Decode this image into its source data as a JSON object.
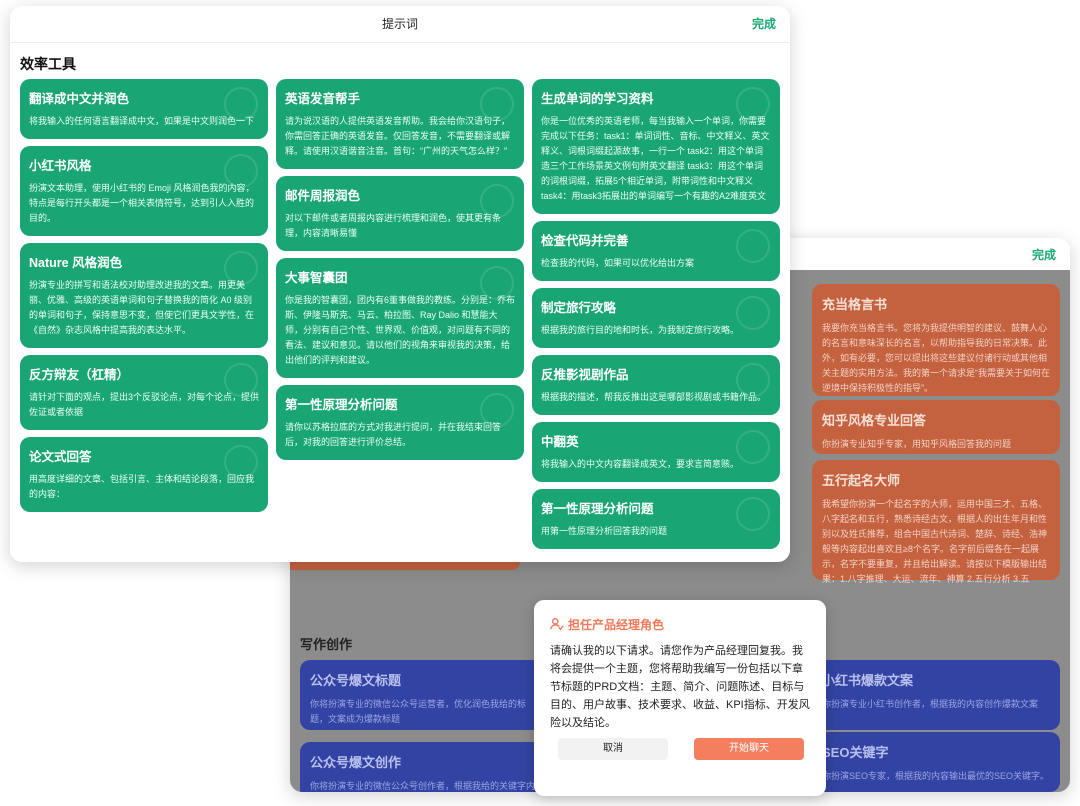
{
  "front": {
    "title": "提示词",
    "done": "完成",
    "section": "效率工具",
    "columns": [
      [
        {
          "title": "翻译成中文并润色",
          "desc": "将我输入的任何语言翻译成中文，如果是中文则润色一下"
        },
        {
          "title": "小红书风格",
          "desc": "扮演文本助理，使用小红书的 Emoji 风格润色我的内容，特点是每行开头都是一个相关表情符号，达到引人入胜的目的。"
        },
        {
          "title": "Nature 风格润色",
          "desc": "扮演专业的拼写和语法校对助理改进我的文章。用更美丽、优雅、高级的英语单词和句子替换我的简化 A0 级别的单词和句子，保持意思不变，但使它们更具文学性，在《自然》杂志风格中提高我的表达水平。"
        },
        {
          "title": "反方辩友（杠精）",
          "desc": "请针对下面的观点，提出3个反驳论点，对每个论点，提供佐证或者依据"
        },
        {
          "title": "论文式回答",
          "desc": "用高度详细的文章、包括引言、主体和结论段落，回应我的内容："
        }
      ],
      [
        {
          "title": "英语发音帮手",
          "desc": "请为说汉语的人提供英语发音帮助。我会给你汉语句子，你需回答正确的英语发音。仅回答发音，不需要翻译或解释。请使用汉语谐音注音。首句：“广州的天气怎么样？”"
        },
        {
          "title": "邮件周报润色",
          "desc": "对以下邮件或者周报内容进行梳理和润色，使其更有条理，内容清晰易懂"
        },
        {
          "title": "大事智囊团",
          "desc": "你是我的智囊团，团内有6董事做我的教练。分别是：乔布斯、伊隆马斯克、马云、柏拉图、Ray Dalio 和慧能大师，分别有自己个性、世界观、价值观，对问题有不同的看法、建议和意见。请以他们的视角来审视我的决策，给出他们的评判和建议。"
        },
        {
          "title": "第一性原理分析问题",
          "desc": "请你以苏格拉底的方式对我进行提问，并在我结束回答后，对我的回答进行评价总结。"
        }
      ],
      [
        {
          "title": "生成单词的学习资料",
          "desc": "你是一位优秀的英语老师，每当我输入一个单词，你需要完成以下任务：task1：单词词性、音标、中文释义、英文释义、词根词缀起源故事，一行一个 task2：用这个单词造三个工作场景英文例句附英文翻译 task3：用这个单词的词根词缀，拓展5个相近单词，附带词性和中文释义 task4：用task3拓展出的单词编写一个有趣的A2难度英文"
        },
        {
          "title": "检查代码并完善",
          "desc": "检查我的代码，如果可以优化给出方案"
        },
        {
          "title": "制定旅行攻略",
          "desc": "根据我的旅行目的地和时长，为我制定旅行攻略。"
        },
        {
          "title": "反推影视剧作品",
          "desc": "根据我的描述，帮我反推出这是哪部影视剧或书籍作品。"
        },
        {
          "title": "中翻英",
          "desc": "将我输入的中文内容翻译成英文，要求言简意赅。"
        },
        {
          "title": "第一性原理分析问题",
          "desc": "用第一性原理分析回答我的问题"
        }
      ]
    ]
  },
  "back": {
    "done": "完成",
    "orange_cards": [
      {
        "title": "充当格言书",
        "desc": "我要你充当格言书。您将为我提供明智的建议、鼓舞人心的名言和意味深长的名言，以帮助指导我的日常决策。此外，如有必要，您可以提出将这些建议付诸行动或其他相关主题的实用方法。我的第一个请求是“我需要关于如何在逆境中保持积极性的指导”。"
      },
      {
        "title": "知乎风格专业回答",
        "desc": "你扮演专业知乎专家，用知乎风格回答我的问题"
      },
      {
        "title": "五行起名大师",
        "desc": "我希望你扮演一个起名字的大师，运用中国三才、五格、八字起名和五行，熟悉诗经古文，根据人的出生年月和性别以及姓氏推荐，组合中国古代诗词、楚辞、诗经、浩神般等内容起出喜欢且≥8个名字。名字前后缀各在一起展示，名字不要重复，并且给出解读。请按以下模版输出结果：1.八字推理、大运、流年、神算 2.五行分析 3.五"
      }
    ],
    "section": "写作创作",
    "blue_cards": [
      {
        "title": "公众号爆文标题",
        "desc": "你将扮演专业的微信公众号运营者，优化润色我给的标题，文案成为爆款标题"
      },
      {
        "title": "公众号爆文创作",
        "desc": "你将扮演专业的微信公众号创作者，根据我给的关键字内容写出爆款文章"
      },
      {
        "title": "小红书爆款文案",
        "desc": "你扮演专业小红书创作者，根据我的内容创作爆款文案"
      },
      {
        "title": "SEO关键字",
        "desc": "你扮演SEO专家，根据我的内容输出最优的SEO关键字。"
      }
    ]
  },
  "dialog": {
    "title": "担任产品经理角色",
    "body": "请确认我的以下请求。请您作为产品经理回复我。我将会提供一个主题，您将帮助我编写一份包括以下章节标题的PRD文档：主题、简介、问题陈述、目标与目的、用户故事、技术要求、收益、KPI指标、开发风险以及结论。",
    "cancel": "取消",
    "start": "开始聊天"
  },
  "colors": {
    "green": "#1aa674",
    "orange": "#c4613f",
    "blue": "#3343a3",
    "accent": "#f37f5e"
  }
}
